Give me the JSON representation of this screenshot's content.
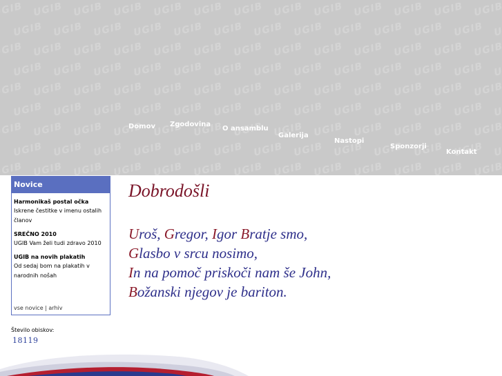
{
  "nav": [
    {
      "id": "domov",
      "label": "Domov"
    },
    {
      "id": "zgodovina",
      "label": "Zgodovina"
    },
    {
      "id": "o-ansamblu",
      "label": "O ansamblu"
    },
    {
      "id": "galerija",
      "label": "Galerija"
    },
    {
      "id": "nastopi",
      "label": "Nastopi"
    },
    {
      "id": "sponzorji",
      "label": "Sponzorji"
    },
    {
      "id": "kontakt",
      "label": "Kontakt"
    }
  ],
  "header": {
    "watermark": "UGIB",
    "background_color": "#c9c9c9"
  },
  "news": {
    "title": "Novice",
    "items": [
      {
        "title": "Harmonikaš postal očka",
        "text": "Iskrene čestitke v imenu ostalih članov"
      },
      {
        "title": "SREČNO 2010",
        "text": "UGIB Vam želi tudi zdravo 2010"
      },
      {
        "title": "UGIB na novih plakatih",
        "text": "Od sedaj bom na plakatih v narodnih nošah"
      }
    ],
    "footer_all": "vse novice",
    "footer_sep": " | ",
    "footer_archive": "arhiv",
    "accent_color": "#5a6fc0"
  },
  "counter": {
    "label": "Število obiskov:",
    "value": "18119"
  },
  "main": {
    "welcome": "Dobrodošli",
    "poem": [
      [
        {
          "cap": "U",
          "rest": "roš, "
        },
        {
          "cap": "G",
          "rest": "regor, "
        },
        {
          "cap": "I",
          "rest": "gor "
        },
        {
          "cap": "B",
          "rest": "ratje smo,"
        }
      ],
      [
        {
          "cap": "G",
          "rest": "lasbo v srcu nosimo,"
        }
      ],
      [
        {
          "cap": "I",
          "rest": "n na pomoč priskoči nam še John,"
        }
      ],
      [
        {
          "cap": "B",
          "rest": "ožanski njegov je bariton."
        }
      ]
    ],
    "welcome_color": "#7a1428",
    "poem_color": "#2e2f8a",
    "cap_color": "#8a1a2a"
  }
}
